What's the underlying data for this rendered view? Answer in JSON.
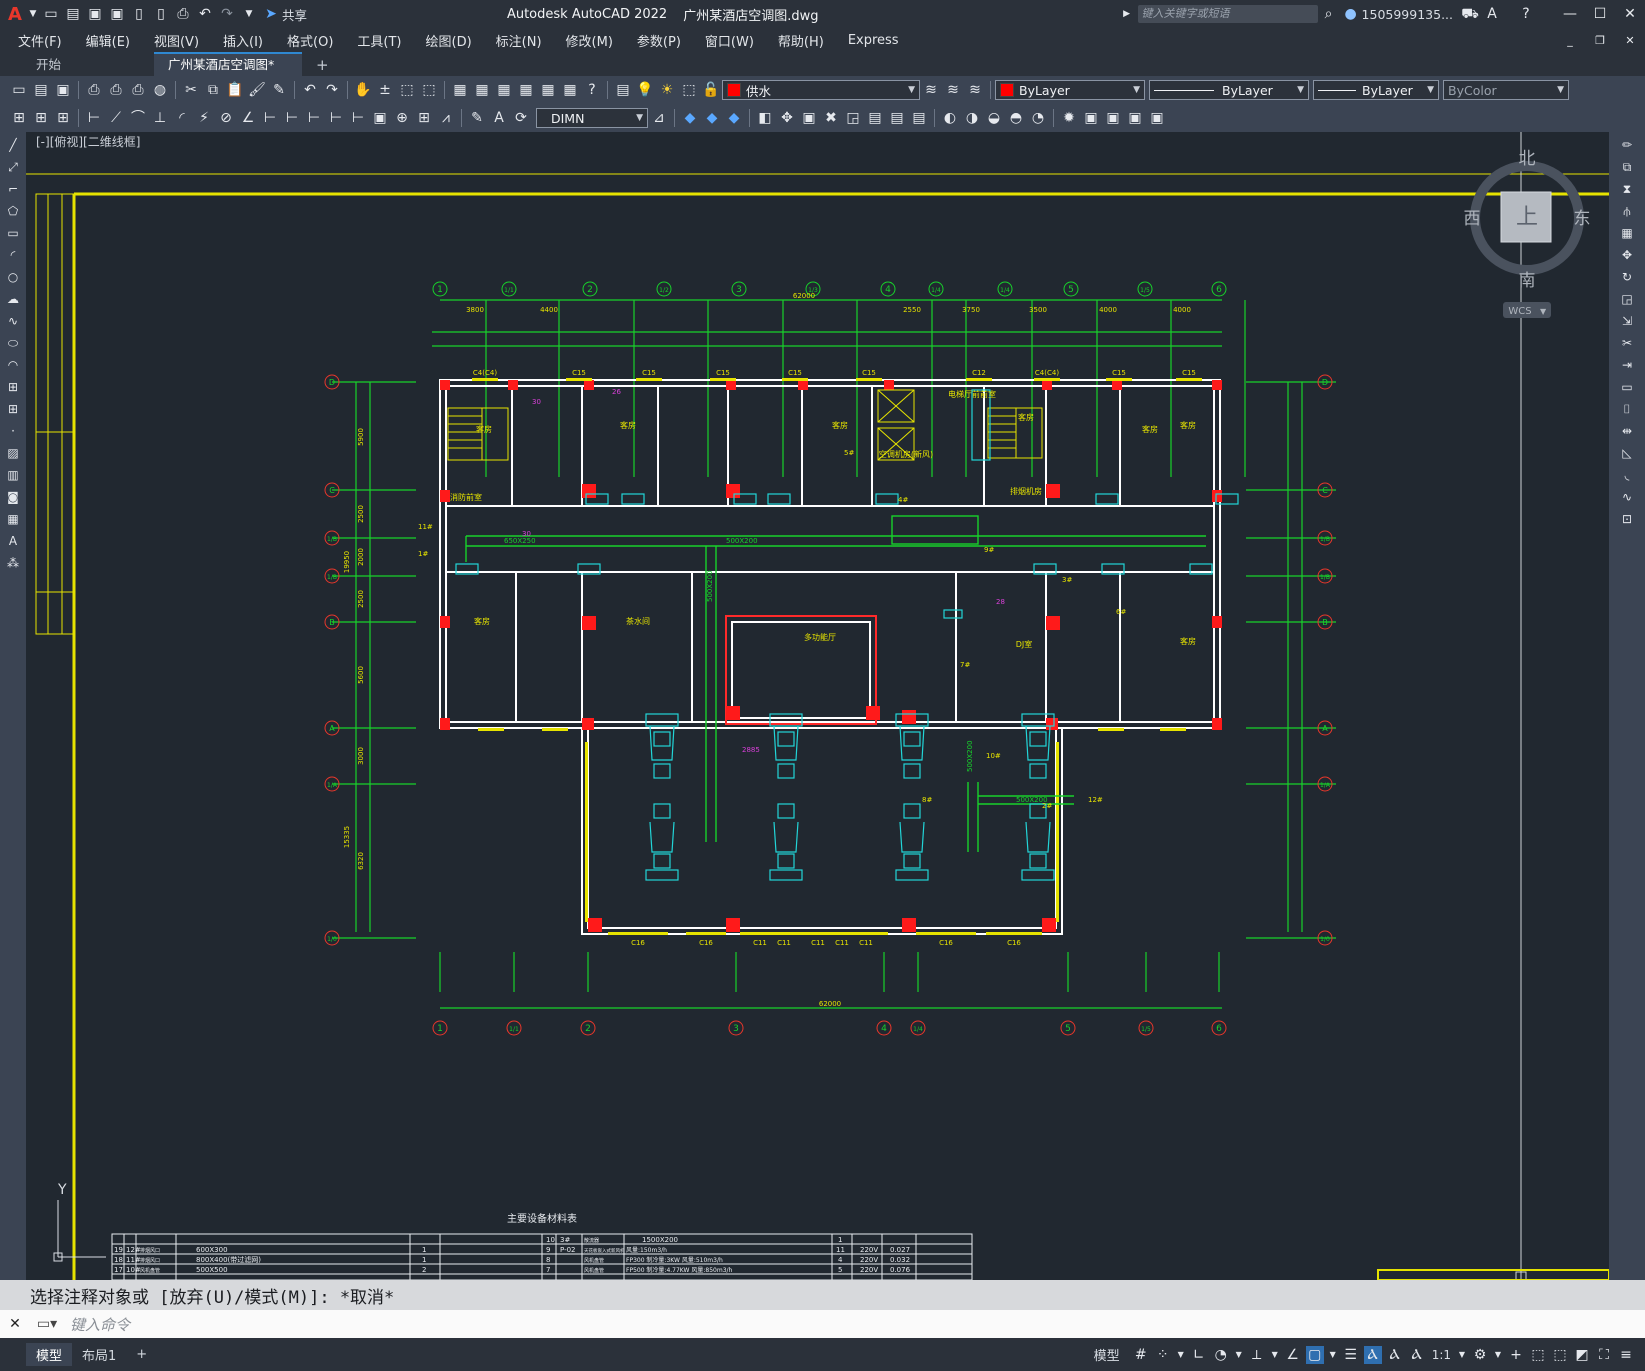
{
  "title": {
    "app": "Autodesk AutoCAD 2022",
    "file": "广州某酒店空调图.dwg",
    "share": "共享",
    "search_placeholder": "键入关键字或短语",
    "user": "1505999135..."
  },
  "menu": [
    "文件(F)",
    "编辑(E)",
    "视图(V)",
    "插入(I)",
    "格式(O)",
    "工具(T)",
    "绘图(D)",
    "标注(N)",
    "修改(M)",
    "参数(P)",
    "窗口(W)",
    "帮助(H)",
    "Express"
  ],
  "tabs": [
    {
      "label": "开始"
    },
    {
      "label": "广州某酒店空调图*"
    }
  ],
  "toolbar1": {
    "layer": "供水",
    "color": "ByLayer",
    "linetype": "ByLayer",
    "lineweight": "ByLayer",
    "plotstyle": "ByColor"
  },
  "toolbar2": {
    "dimstyle": "DIMN"
  },
  "viewport_label": "[-][俯视][二维线框]",
  "viewcube": {
    "north": "北",
    "south": "南",
    "east": "东",
    "west": "西",
    "top": "上",
    "wcs": "WCS"
  },
  "drawing": {
    "grid_top": [
      "1",
      "1/1",
      "2",
      "1/2",
      "3",
      "1/3",
      "4",
      "1/4",
      "1/4",
      "5",
      "1/5",
      "6"
    ],
    "grid_bottom": [
      "1",
      "1/1",
      "2",
      "3",
      "4",
      "1/4",
      "5",
      "1/5",
      "6"
    ],
    "grid_side": [
      "D",
      "C",
      "1/B",
      "1/B",
      "B",
      "A",
      "1/A",
      "1/0"
    ],
    "dims_top": [
      "3800",
      "4400",
      "62000",
      "2550",
      "3750",
      "3500",
      "4000",
      "4000"
    ],
    "dim_bottom": "62000",
    "rooms": [
      "客房",
      "客房",
      "客房",
      "客房",
      "电梯厅前前室",
      "空调机房(新风)",
      "排烟机房",
      "客房",
      "客房",
      "茶水间",
      "多功能厅",
      "DJ室",
      "客房",
      "客房",
      "消防前室"
    ],
    "room_numbers": [
      "30",
      "26",
      "28",
      "30",
      "2885"
    ],
    "windows": [
      "C4(C4)",
      "C15",
      "C15",
      "C15",
      "C15",
      "C15",
      "C12",
      "C4(C4)",
      "C15",
      "C15",
      "C16",
      "C16",
      "C11",
      "C11",
      "C11",
      "C11",
      "C11",
      "C16",
      "C16"
    ],
    "ducts": [
      "650X250",
      "500X200",
      "500X200",
      "500X200",
      "500X200"
    ],
    "pipes": [
      "11#",
      "1#",
      "5#",
      "4#",
      "9#",
      "3#",
      "6#",
      "7#",
      "8#",
      "10#",
      "2#",
      "12#"
    ],
    "dims_left": [
      "5900",
      "2500",
      "2000",
      "2500",
      "5600",
      "3000",
      "6320",
      "19950",
      "15335"
    ]
  },
  "table": {
    "title": "主要设备材料表",
    "left_rows": [
      [
        "19",
        "12#",
        "排烟风口",
        "600X300",
        "1"
      ],
      [
        "18",
        "11#",
        "排烟风口",
        "800X400(带过滤网)",
        "1"
      ],
      [
        "17",
        "10#",
        "风机盘管",
        "500X500",
        "2"
      ]
    ],
    "right_rows": [
      [
        "10",
        "3#",
        "散流器",
        "1500X200",
        "1",
        "",
        ""
      ],
      [
        "9",
        "P-02",
        "天花板嵌入式新风机",
        "风量:150m3/h",
        "11",
        "220V",
        "0.027"
      ],
      [
        "8",
        "",
        "风机盘管",
        "FP300 制冷量:3KW 风量:510m3/h",
        "4",
        "220V",
        "0.032"
      ],
      [
        "7",
        "",
        "风机盘管",
        "FP500 制冷量:4.77KW 风量:850m3/h",
        "5",
        "220V",
        "0.076"
      ]
    ]
  },
  "command": {
    "history": "选择注释对象或 [放弃(U)/模式(M)]: *取消*",
    "placeholder": "键入命令"
  },
  "status": {
    "tabs": [
      "模型",
      "布局1"
    ],
    "model": "模型",
    "scale": "1:1"
  }
}
